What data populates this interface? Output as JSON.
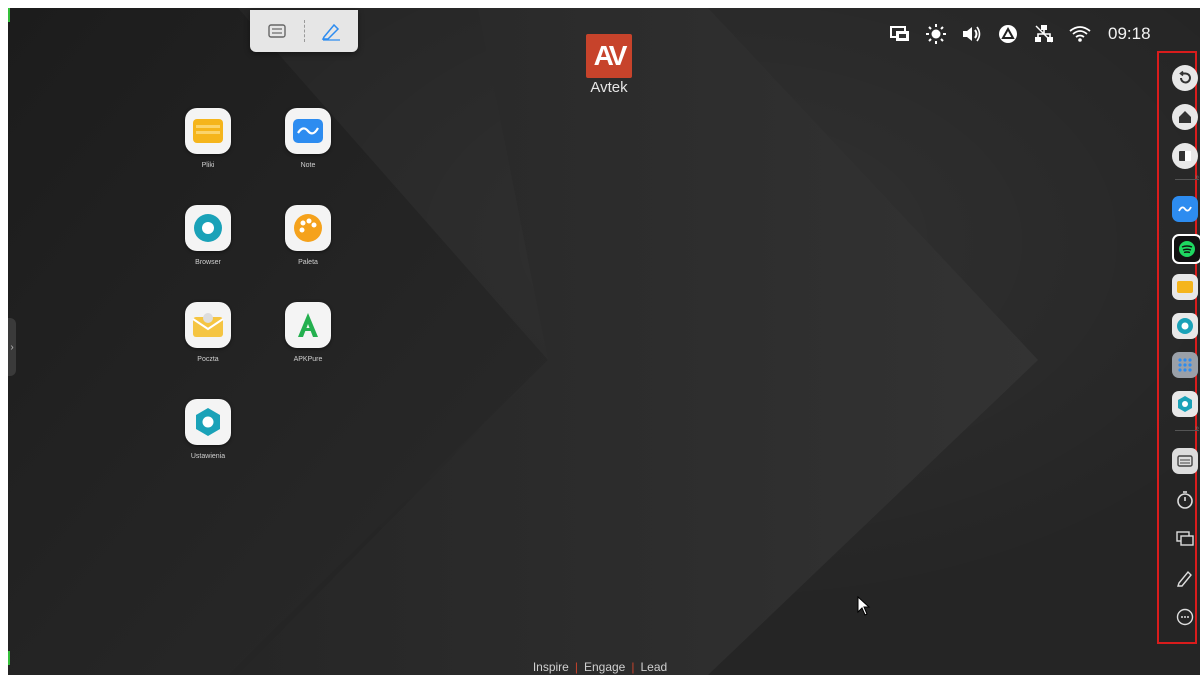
{
  "brand": {
    "logo_text": "AV",
    "name": "Avtek"
  },
  "status_bar": {
    "icons": [
      "screen-mirror-icon",
      "brightness-icon",
      "volume-icon",
      "triangle-app-icon",
      "network-icon",
      "wifi-icon"
    ],
    "time": "09:18"
  },
  "top_toolbar": {
    "items": [
      "freeze-icon",
      "pen-icon"
    ]
  },
  "desktop_apps": [
    {
      "label": "Pliki",
      "icon": "folder-icon",
      "color": "#f5b51c"
    },
    {
      "label": "Note",
      "icon": "note-icon",
      "color": "#2d8cf0"
    },
    {
      "label": "Browser",
      "icon": "browser-icon",
      "color": "#1aa2b8"
    },
    {
      "label": "Paleta",
      "icon": "palette-icon",
      "color": "#f5a21c"
    },
    {
      "label": "Poczta",
      "icon": "mail-icon",
      "color": "#f5c542"
    },
    {
      "label": "APKPure",
      "icon": "apkpure-icon",
      "color": "#24b04f"
    },
    {
      "label": "Ustawienia",
      "icon": "settings-icon",
      "color": "#1aa2b8"
    }
  ],
  "sidebar": {
    "items": [
      {
        "name": "back-icon"
      },
      {
        "name": "home-icon"
      },
      {
        "name": "recent-apps-icon"
      },
      {
        "name": "note-app-icon"
      },
      {
        "name": "spotify-icon"
      },
      {
        "name": "files-app-icon"
      },
      {
        "name": "browser-app-icon"
      },
      {
        "name": "all-apps-icon"
      },
      {
        "name": "settings-app-icon"
      },
      {
        "name": "freeze-icon"
      },
      {
        "name": "timer-icon"
      },
      {
        "name": "screen-cast-icon"
      },
      {
        "name": "annotate-pen-icon"
      },
      {
        "name": "more-icon"
      }
    ],
    "divider_glyph": "»",
    "accent": "#d91c1c"
  },
  "left_handle_glyph": "›",
  "footer": {
    "inspire": "Inspire",
    "engage": "Engage",
    "lead": "Lead",
    "separator": "|"
  }
}
